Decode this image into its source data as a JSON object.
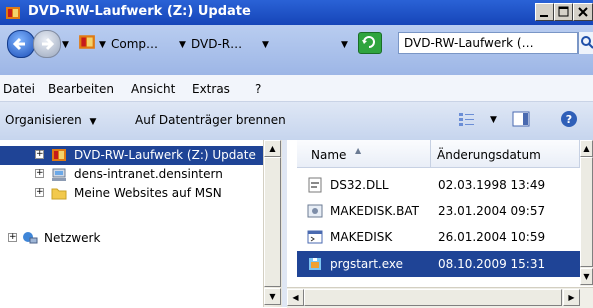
{
  "window": {
    "title": "DVD-RW-Laufwerk (Z:) Update"
  },
  "address": {
    "crumbs": [
      "Comp…",
      "DVD-R…"
    ],
    "search_text": "DVD-RW-Laufwerk (…"
  },
  "menu": {
    "datei": "Datei",
    "bearbeiten": "Bearbeiten",
    "ansicht": "Ansicht",
    "extras": "Extras",
    "help": "?"
  },
  "commands": {
    "organize": "Organisieren",
    "burn": "Auf Datenträger brennen"
  },
  "tree": {
    "items": [
      {
        "label": "DVD-RW-Laufwerk (Z:) Update",
        "expander": "+",
        "icon": "dvd-drive-icon"
      },
      {
        "label": "dens-intranet.densintern",
        "expander": "+",
        "icon": "network-drive-icon"
      },
      {
        "label": "Meine Websites auf MSN",
        "expander": "+",
        "icon": "folder-icon"
      },
      {
        "label": "Netzwerk",
        "expander": "+",
        "icon": "network-icon"
      }
    ]
  },
  "list": {
    "columns": {
      "name": "Name",
      "date": "Änderungsdatum"
    },
    "files": [
      {
        "name": "DS32.DLL",
        "date": "02.03.1998 13:49",
        "icon": "dll-file-icon"
      },
      {
        "name": "MAKEDISK.BAT",
        "date": "23.01.2004 09:57",
        "icon": "batch-file-icon"
      },
      {
        "name": "MAKEDISK",
        "date": "26.01.2004 10:59",
        "icon": "program-file-icon"
      },
      {
        "name": "prgstart.exe",
        "date": "08.10.2009 15:31",
        "icon": "setup-exe-icon"
      }
    ]
  },
  "colors": {
    "titlebar": "#1f4fc4",
    "selection": "#1f4496"
  }
}
